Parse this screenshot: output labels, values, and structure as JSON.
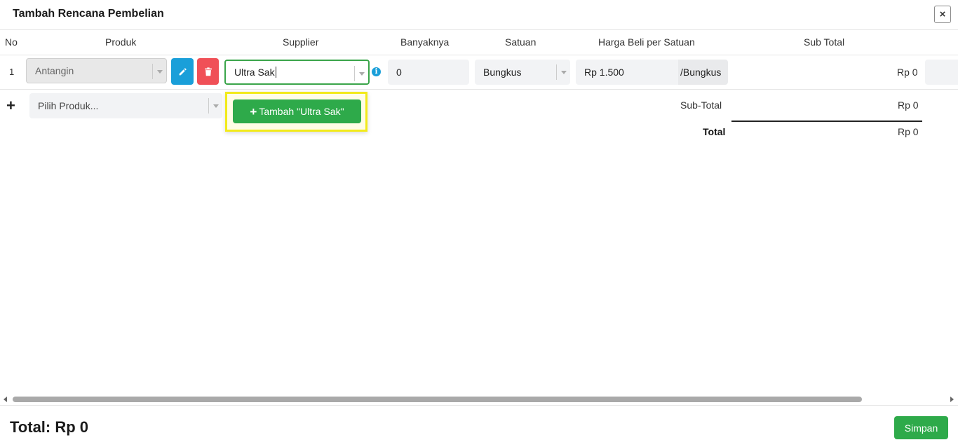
{
  "modal": {
    "title": "Tambah Rencana Pembelian",
    "close_label": "×"
  },
  "table": {
    "headers": [
      "No",
      "Produk",
      "Supplier",
      "Banyaknya",
      "Satuan",
      "Harga Beli per Satuan",
      "Sub Total"
    ],
    "rows": [
      {
        "no": "1",
        "produk": "Antangin",
        "supplier_input": "Ultra Sak",
        "banyaknya": "0",
        "satuan": "Bungkus",
        "harga": "Rp 1.500",
        "harga_suffix": "/Bungkus",
        "sub_total": "Rp 0"
      }
    ]
  },
  "new_row": {
    "produk_placeholder": "Pilih Produk...",
    "add_button_label": "Tambah \"Ultra Sak\""
  },
  "summary": {
    "subtotal_label": "Sub-Total",
    "subtotal_value": "Rp 0",
    "total_label": "Total",
    "total_value": "Rp 0"
  },
  "footer": {
    "total_text": "Total: Rp 0",
    "save_label": "Simpan"
  },
  "colors": {
    "accent_green": "#2eaa4a",
    "edit_blue": "#1a9fd9",
    "delete_red": "#f05057",
    "highlight_yellow": "#f2ea1a"
  },
  "icons": {
    "close": "close-icon",
    "edit": "pencil-icon",
    "delete": "trash-icon",
    "info": "info-icon",
    "add_row": "plus-icon"
  }
}
